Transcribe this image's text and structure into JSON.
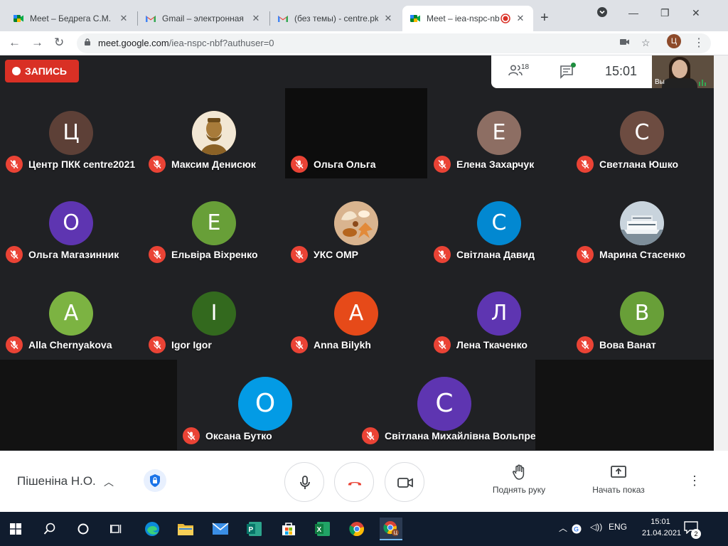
{
  "browser": {
    "tabs": [
      {
        "title": "Meet – Бедрега С.М.",
        "icon": "meet-icon",
        "active": false
      },
      {
        "title": "Gmail – электронная п",
        "icon": "gmail-icon",
        "active": false
      },
      {
        "title": "(без темы) - centre.pkk",
        "icon": "gmail-icon",
        "active": false
      },
      {
        "title": "Meet – iea-nspc-nb",
        "icon": "meet-icon",
        "active": true
      }
    ],
    "url_host": "meet.google.com",
    "url_path": "/iea-nspc-nbf?authuser=0",
    "profile_letter": "Ц"
  },
  "meet": {
    "record_label": "ЗАПИСЬ",
    "participant_count": "18",
    "time": "15:01",
    "self_label": "Вы",
    "participants": [
      {
        "name": "Центр ПКК centre2021",
        "initial": "Ц",
        "color": "#5d4037",
        "type": "avatar"
      },
      {
        "name": "Максим Денисюк",
        "initial": "",
        "color": "#b08a4a",
        "type": "photo-statue"
      },
      {
        "name": "Ольга Ольга",
        "initial": "",
        "color": "#0d0d0d",
        "type": "video"
      },
      {
        "name": "Елена Захарчук",
        "initial": "Е",
        "color": "#8d6e63",
        "type": "avatar"
      },
      {
        "name": "Светлана Юшко",
        "initial": "С",
        "color": "#6d4c41",
        "type": "avatar"
      },
      {
        "name": "Ольга Магазинник",
        "initial": "О",
        "color": "#5e35b1",
        "type": "avatar"
      },
      {
        "name": "Ельвіра Віхренко",
        "initial": "Е",
        "color": "#689f38",
        "type": "avatar"
      },
      {
        "name": "УКС ОМР",
        "initial": "",
        "color": "#c8a27c",
        "type": "photo-shells"
      },
      {
        "name": "Світлана Давид",
        "initial": "С",
        "color": "#0288d1",
        "type": "avatar"
      },
      {
        "name": "Марина Стасенко",
        "initial": "",
        "color": "#9aa6b2",
        "type": "photo-ship"
      },
      {
        "name": "Alla Chernyakova",
        "initial": "A",
        "color": "#7cb342",
        "type": "avatar"
      },
      {
        "name": "Igor Igor",
        "initial": "I",
        "color": "#33691e",
        "type": "avatar"
      },
      {
        "name": "Anna Bilykh",
        "initial": "A",
        "color": "#e64a19",
        "type": "avatar"
      },
      {
        "name": "Лена Ткаченко",
        "initial": "Л",
        "color": "#5e35b1",
        "type": "avatar"
      },
      {
        "name": "Вова Ванат",
        "initial": "В",
        "color": "#689f38",
        "type": "avatar"
      },
      {
        "name": "Оксана Бутко",
        "initial": "О",
        "color": "#039be5",
        "type": "avatar"
      },
      {
        "name": "Світлана Михайлівна Вольпрес",
        "initial": "С",
        "color": "#5e35b1",
        "type": "avatar"
      }
    ]
  },
  "controls": {
    "meeting_name": "Пішеніна Н.О.",
    "raise_hand_label": "Поднять руку",
    "present_label": "Начать показ"
  },
  "taskbar": {
    "lang": "ENG",
    "time": "15:01",
    "date": "21.04.2021",
    "notifications": "2"
  },
  "colors": {
    "meet_background": "#202124",
    "record_red": "#d93025",
    "mute_red": "#ea4335",
    "hangup_red": "#ea4335",
    "taskbar": "#101c2e"
  }
}
